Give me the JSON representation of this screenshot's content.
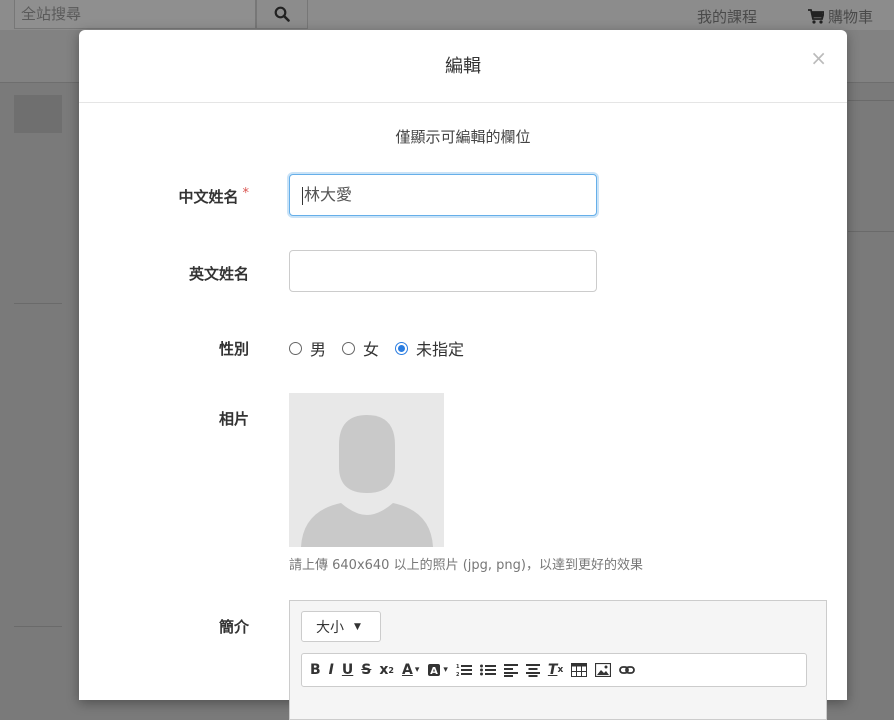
{
  "background": {
    "search_placeholder": "全站搜尋",
    "nav_courses": "我的課程",
    "nav_cart": "購物車"
  },
  "modal": {
    "title": "編輯",
    "close": "×",
    "notice": "僅顯示可編輯的欄位",
    "fields": {
      "chinese_name": {
        "label": "中文姓名",
        "required_mark": "*",
        "value": "林大愛"
      },
      "english_name": {
        "label": "英文姓名",
        "value": ""
      },
      "gender": {
        "label": "性別",
        "options": [
          "男",
          "女",
          "未指定"
        ],
        "selected": "未指定"
      },
      "photo": {
        "label": "相片",
        "hint": "請上傳 640x640 以上的照片 (jpg, png)，以達到更好的效果"
      },
      "bio": {
        "label": "簡介",
        "size_dropdown": "大小"
      }
    }
  },
  "colors": {
    "accent": "#2a7de1",
    "focus_border": "#66afe9",
    "required": "#d9534f"
  }
}
